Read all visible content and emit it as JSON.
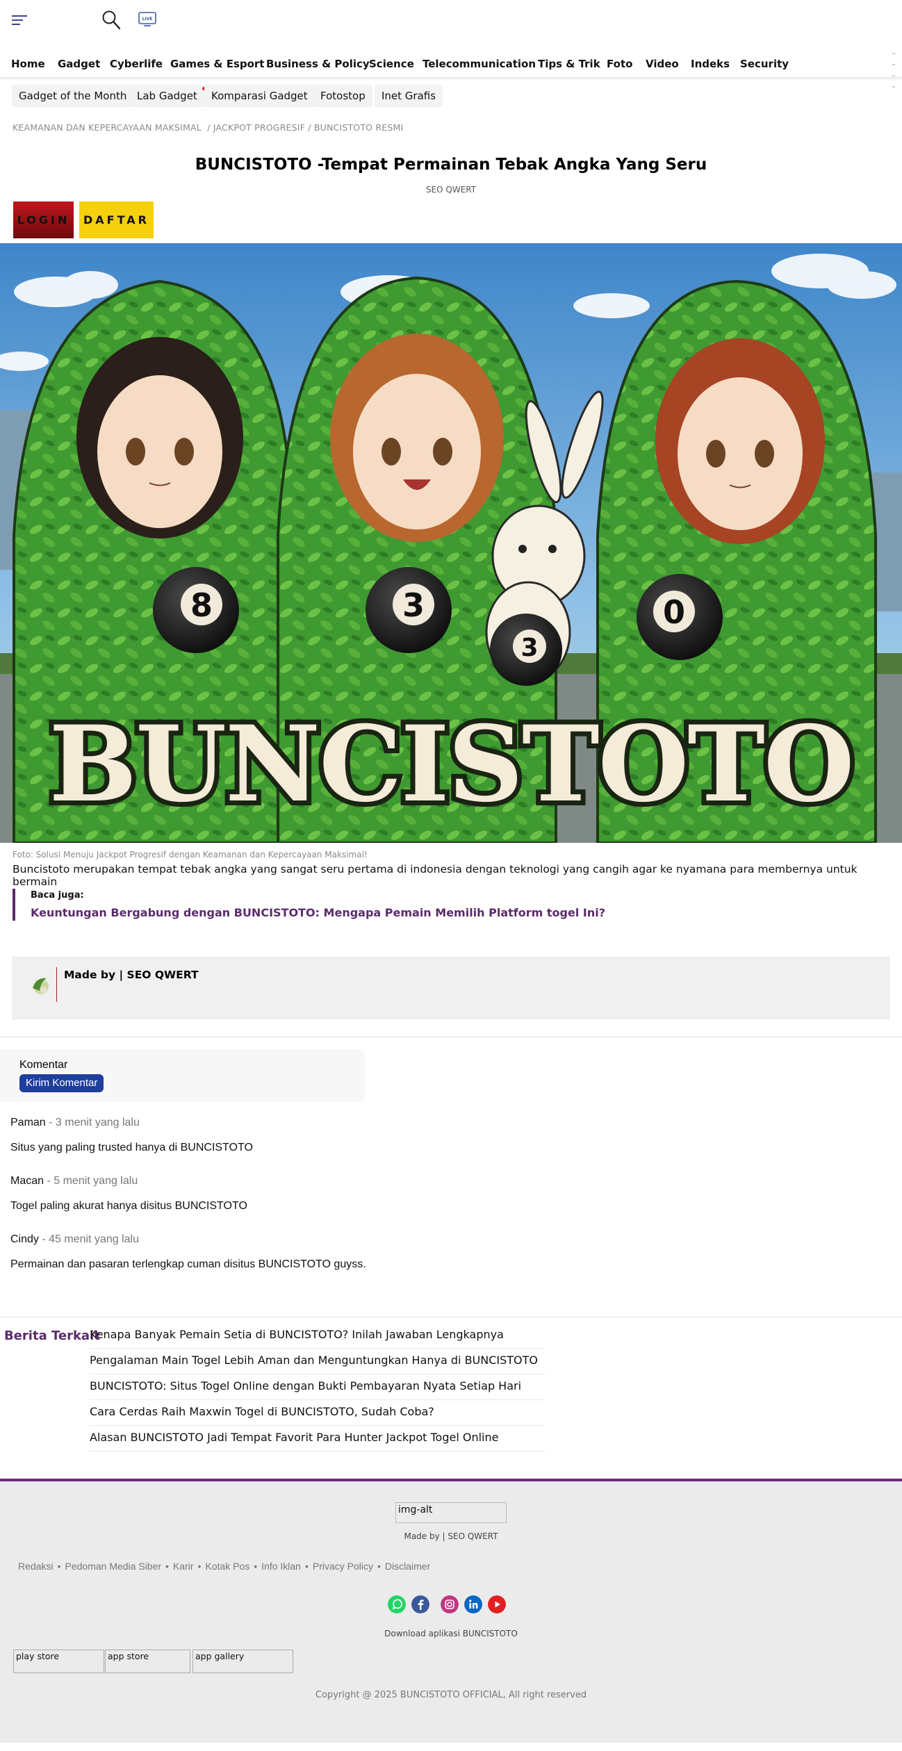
{
  "header": {
    "menu_icon": "hamburger-menu-icon",
    "search_icon": "search-icon",
    "live_icon": "live-tv-icon",
    "live_label": "LIVE"
  },
  "nav": {
    "items": [
      "Home",
      "Gadget",
      "Cyberlife",
      "Games & Esport",
      "Business & Policy",
      "Science",
      "Telecommunication",
      "Tips & Trik",
      "Foto",
      "Video",
      "Indeks",
      "Security"
    ]
  },
  "subnav": {
    "items": [
      {
        "label": "Gadget of the Month",
        "dot": true
      },
      {
        "label": "Lab Gadget",
        "dot": true
      },
      {
        "label": "Komparasi Gadget",
        "dot": false
      },
      {
        "label": "Fotostop",
        "dot": false
      },
      {
        "label": "Inet Grafis",
        "dot": false
      }
    ]
  },
  "breadcrumb": {
    "first": "KEAMANAN DAN KEPERCAYAAN MAKSIMAL",
    "second": "/ JACKPOT PROGRESIF / BUNCISTOTO RESMI"
  },
  "article": {
    "title": "BUNCISTOTO -Tempat Permainan Tebak Angka Yang Seru",
    "author": "SEO QWERT",
    "login_label": "LOGIN",
    "daftar_label": "DAFTAR",
    "hero_text": "BUNCISTOTO",
    "ball_numbers": [
      "8",
      "3",
      "3",
      "0"
    ],
    "caption": "Foto: Solusi Menuju Jackpot Progresif dengan Keamanan dan Kepercayaan Maksimal!",
    "lede": "Buncistoto merupakan tempat tebak angka yang sangat seru pertama di indonesia dengan teknologi yang cangih agar ke nyamana para membernya untuk bermain",
    "read_also_label": "Baca juga:",
    "read_also_link": "Keuntungan Bergabung dengan BUNCISTOTO: Mengapa Pemain Memilih Platform togel Ini?",
    "made_by": "Made by | SEO QWERT"
  },
  "comments": {
    "label": "Komentar",
    "send_label": "Kirim Komentar",
    "items": [
      {
        "name": "Paman",
        "time": " - 3 menit yang lalu",
        "text": "Situs yang paling trusted hanya di BUNCISTOTO"
      },
      {
        "name": "Macan",
        "time": " - 5 menit yang lalu",
        "text": "Togel paling akurat hanya disitus BUNCISTOTO"
      },
      {
        "name": "Cindy",
        "time": " - 45 menit yang lalu",
        "text": "Permainan dan pasaran terlengkap cuman disitus BUNCISTOTO guyss."
      }
    ]
  },
  "related": {
    "heading": "Berita Terkait",
    "items": [
      "Kenapa Banyak Pemain Setia di BUNCISTOTO? Inilah Jawaban Lengkapnya",
      "Pengalaman Main Togel Lebih Aman dan Menguntungkan Hanya di BUNCISTOTO",
      "BUNCISTOTO: Situs Togel Online dengan Bukti Pembayaran Nyata Setiap Hari",
      "Cara Cerdas Raih Maxwin Togel di BUNCISTOTO, Sudah Coba?",
      "Alasan BUNCISTOTO Jadi Tempat Favorit Para Hunter Jackpot Togel Online"
    ]
  },
  "footer": {
    "img_alt": "img-alt",
    "made_by": "Made by | SEO QWERT",
    "links": [
      "Redaksi",
      "Pedoman Media Siber",
      "Karir",
      "Kotak Pos",
      "Info Iklan",
      "Privacy Policy",
      "Disclaimer"
    ],
    "socials": [
      {
        "name": "whatsapp-icon",
        "color": "#25d366"
      },
      {
        "name": "facebook-icon",
        "color": "#3b5998"
      },
      {
        "name": "instagram-icon",
        "color": "#c13584"
      },
      {
        "name": "linkedin-icon",
        "color": "#0a66c2"
      },
      {
        "name": "youtube-icon",
        "color": "#e02020"
      }
    ],
    "download": "Download aplikasi BUNCISTOTO",
    "stores": [
      "play store",
      "app store",
      "app gallery"
    ],
    "copyright": "Copyright @ 2025 BUNCISTOTO OFFICIAL, All right reserved"
  },
  "colors": {
    "accent_purple": "#5b2b6b",
    "kirim_blue": "#1f3f9e",
    "login_red": "#b0131a",
    "daftar_yellow": "#f5d00c"
  }
}
